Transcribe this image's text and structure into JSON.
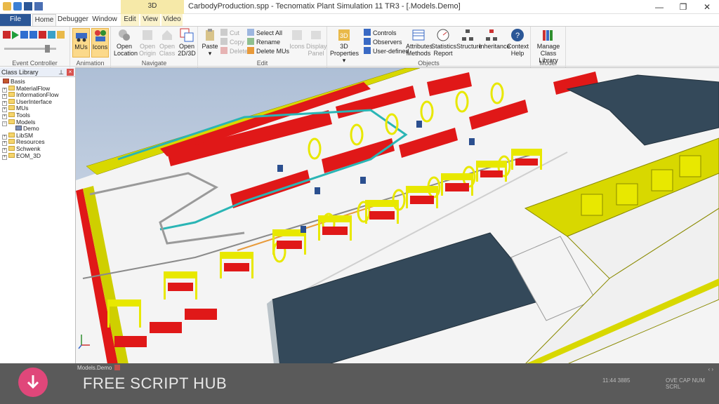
{
  "window": {
    "title": "CarbodyProduction.spp - Tecnomatix Plant Simulation 11 TR3 - [.Models.Demo]",
    "context_tab": "3D",
    "controls": [
      "—",
      "❐",
      "✕"
    ]
  },
  "tabs": [
    "File",
    "Home",
    "Debugger",
    "Window",
    "Edit",
    "View",
    "Video"
  ],
  "ribbon": {
    "groups": {
      "event_controller": "Event Controller",
      "animation": "Animation",
      "navigate": "Navigate",
      "edit": "Edit",
      "objects": "Objects",
      "model": "Model"
    },
    "animation": {
      "mus": "MUs",
      "icons": "Icons"
    },
    "navigate": {
      "open_location": [
        "Open",
        "Location"
      ],
      "open_origin": [
        "Open",
        "Origin"
      ],
      "open_class": [
        "Open",
        "Class"
      ],
      "open_2d3d": [
        "Open",
        "2D/3D"
      ]
    },
    "edit": {
      "paste": "Paste",
      "cut": "Cut",
      "copy": "Copy",
      "delete": "Delete",
      "select_all": "Select All",
      "rename": "Rename",
      "delete_mus": "Delete MUs",
      "icons": "Icons",
      "display_panel": [
        "Display",
        "Panel"
      ]
    },
    "objects": {
      "properties_3d": [
        "3D",
        "Properties"
      ],
      "controls": "Controls",
      "observers": "Observers",
      "user_defined": "User-defined",
      "attributes_methods": [
        "Attributes",
        "Methods"
      ],
      "statistics_report": [
        "Statistics",
        "Report"
      ],
      "structure": "Structure",
      "inheritance": "Inheritance",
      "context_help": [
        "Context",
        "Help"
      ]
    },
    "model": {
      "manage_class_library": [
        "Manage",
        "Class Library"
      ]
    }
  },
  "class_library": {
    "title": "Class Library",
    "root": "Basis",
    "items": [
      "MaterialFlow",
      "InformationFlow",
      "UserInterface",
      "MUs",
      "Tools",
      "Models",
      "Demo",
      "LibSM",
      "Resources",
      "Schwenk",
      "EOM_3D"
    ]
  },
  "statusbar": {
    "doc_tab": "Models.Demo",
    "brand": "FREE SCRIPT HUB",
    "time": "11:44 3885",
    "flags": "OVE CAP NUM SCRL"
  },
  "colors": {
    "accent": "#2b5797",
    "conveyor_yellow": "#e8e800",
    "car_red": "#e01818",
    "roof_slate": "#34495a",
    "floor": "#f4f4f4"
  }
}
